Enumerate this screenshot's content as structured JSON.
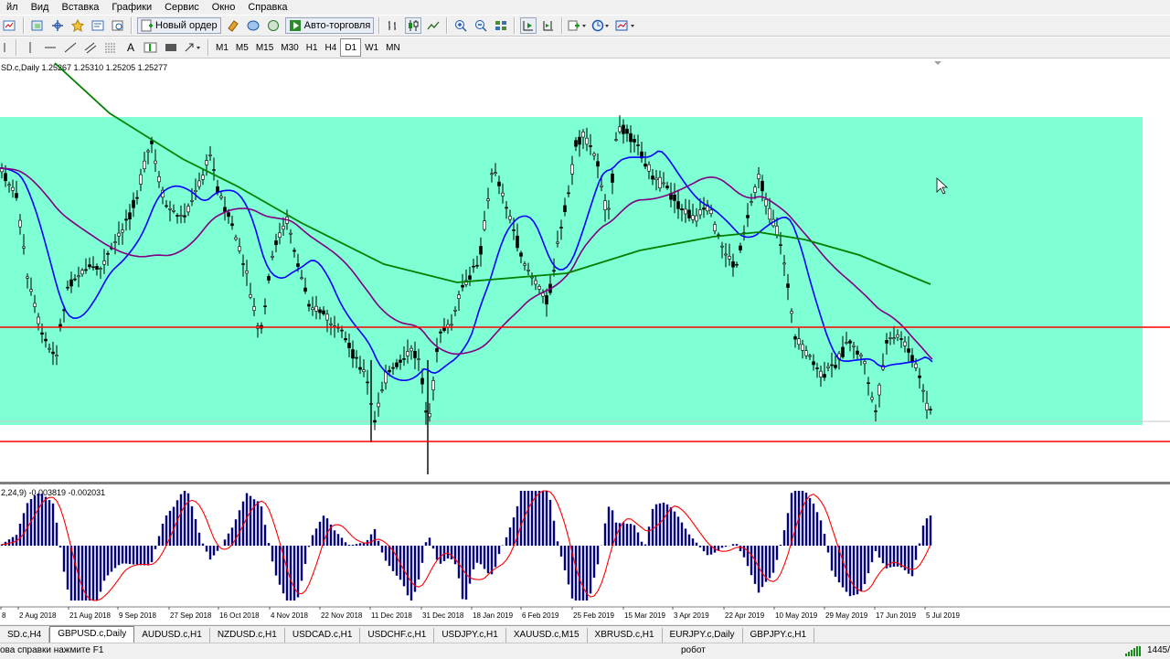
{
  "menubar": {
    "items": [
      "йл",
      "Вид",
      "Вставка",
      "Графики",
      "Сервис",
      "Окно",
      "Справка"
    ]
  },
  "toolbar1": {
    "new_order_label": "Новый ордер",
    "autotrade_label": "Авто-торговля"
  },
  "toolbar2": {
    "draw_text_tool": "A",
    "timeframes": [
      "M1",
      "M5",
      "M15",
      "M30",
      "H1",
      "H4",
      "D1",
      "W1",
      "MN"
    ],
    "active_timeframe": "D1"
  },
  "chart": {
    "header": "SD.c,Daily  1.25267 1.25310 1.25205 1.25277",
    "indicator_header": "2,24,9) -0.003819 -0.002031",
    "x_labels": [
      "8",
      "2 Aug 2018",
      "21 Aug 2018",
      "9 Sep 2018",
      "27 Sep 2018",
      "16 Oct 2018",
      "4 Nov 2018",
      "22 Nov 2018",
      "11 Dec 2018",
      "31 Dec 2018",
      "18 Jan 2019",
      "6 Feb 2019",
      "25 Feb 2019",
      "15 Mar 2019",
      "3 Apr 2019",
      "22 Apr 2019",
      "10 May 2019",
      "29 May 2019",
      "17 Jun 2019",
      "5 Jul 2019"
    ],
    "colors": {
      "zone": "#7fffd4",
      "price_bars": "#000000",
      "ma_fast": "#0000ff",
      "ma_mid": "#800080",
      "ma_slow": "#008000",
      "levels": "#ff0000",
      "macd_hist": "#000080",
      "macd_signal": "#ff0000"
    }
  },
  "tabs": [
    "SD.c,H4",
    "GBPUSD.c,Daily",
    "AUDUSD.c,H1",
    "NZDUSD.c,H1",
    "USDCAD.c,H1",
    "USDCHF.c,H1",
    "USDJPY.c,H1",
    "XAUUSD.c,M15",
    "XBRUSD.c,H1",
    "EURJPY.c,Daily",
    "GBPJPY.c,H1"
  ],
  "active_tab": "GBPUSD.c,Daily",
  "status": {
    "help": "ова справки нажмите F1",
    "profile": "робот",
    "traffic": "1445/"
  }
}
